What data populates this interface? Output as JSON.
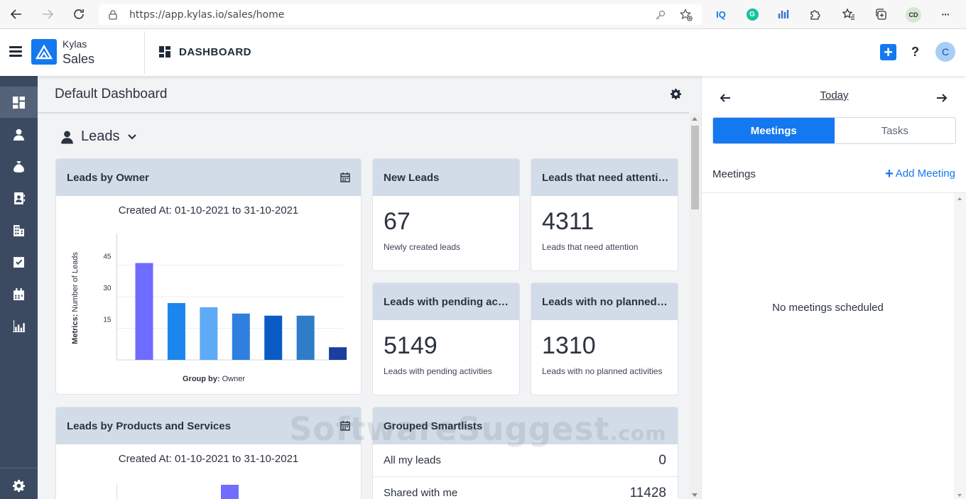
{
  "browser": {
    "url": "https://app.kylas.io/sales/home",
    "ext_iq": "IQ",
    "ext_g": "G",
    "profile": "CD",
    "more": "···"
  },
  "header": {
    "brand_top": "Kylas",
    "brand_bottom": "Sales",
    "page": "DASHBOARD",
    "help": "?",
    "plus": "+",
    "user_initial": "C"
  },
  "main": {
    "title": "Default Dashboard",
    "section": "Leads"
  },
  "cards": {
    "by_owner": {
      "title": "Leads by Owner",
      "subtitle": "Created At: 01-10-2021 to 31-10-2021"
    },
    "new_leads": {
      "title": "New Leads",
      "value": "67",
      "caption": "Newly created leads"
    },
    "attention": {
      "title": "Leads that need attention",
      "value": "4311",
      "caption": "Leads that need attention"
    },
    "pending": {
      "title": "Leads with pending activities",
      "value": "5149",
      "caption": "Leads with pending activities"
    },
    "no_planned": {
      "title": "Leads with no planned activities",
      "value": "1310",
      "caption": "Leads with no planned activities"
    },
    "by_products": {
      "title": "Leads by Products and Services",
      "subtitle": "Created At: 01-10-2021 to 31-10-2021"
    },
    "smartlists": {
      "title": "Grouped Smartlists",
      "rows": [
        {
          "name": "All my leads",
          "value": "0"
        },
        {
          "name": "Shared with me",
          "value": "11428"
        }
      ]
    }
  },
  "chart_data": [
    {
      "type": "bar",
      "title": "Created At: 01-10-2021 to 31-10-2021",
      "ylabel_prefix": "Metrics:",
      "ylabel": "Number of Leads",
      "xlabel_prefix": "Group by:",
      "xlabel": "Owner",
      "ylim": [
        0,
        60
      ],
      "yticks": [
        15,
        30,
        45
      ],
      "grid": true,
      "values": [
        46,
        27,
        25,
        22,
        21,
        21,
        6
      ],
      "colors": [
        "#6f6cff",
        "#1a86ee",
        "#5eaaf7",
        "#2f7fe0",
        "#0b5bc4",
        "#2f7dc8",
        "#1b3f9e"
      ]
    },
    {
      "type": "bar",
      "title": "Created At: 01-10-2021 to 31-10-2021",
      "colors": [
        "#6f6cff"
      ]
    }
  ],
  "right_panel": {
    "today": "Today",
    "tabs": [
      "Meetings",
      "Tasks"
    ],
    "label": "Meetings",
    "add": "Add Meeting",
    "add_plus": "+",
    "empty": "No meetings scheduled"
  },
  "watermark": {
    "main": "SoftwareSuggest",
    "suffix": ".com"
  }
}
